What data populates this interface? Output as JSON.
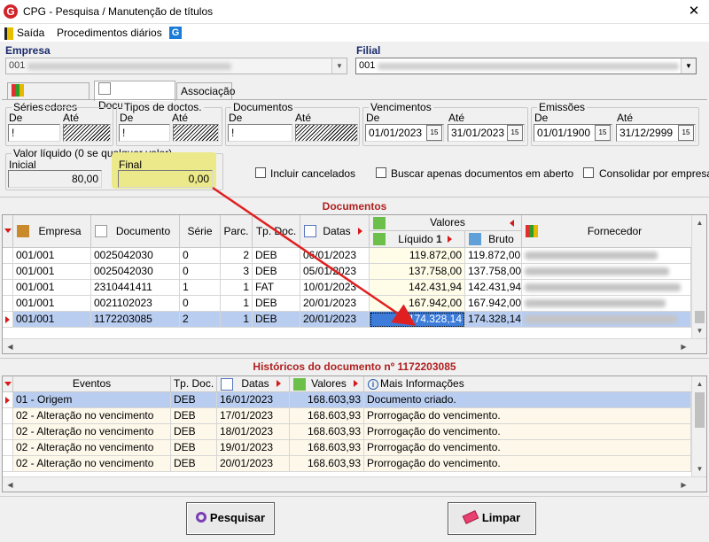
{
  "window": {
    "title": "CPG - Pesquisa / Manutenção de títulos",
    "close_glyph": "✕"
  },
  "menu": {
    "items": [
      "Saída",
      "Procedimentos diários"
    ]
  },
  "empresa": {
    "label": "Empresa",
    "value": "001"
  },
  "filial": {
    "label": "Filial",
    "value": "001"
  },
  "tabs": [
    "Fornecedores",
    "Documentos",
    "Associação"
  ],
  "filters": {
    "series": {
      "title": "Séries",
      "de_label": "De",
      "ate_label": "Até",
      "de_value": "!",
      "ate_value": ""
    },
    "tipos": {
      "title": "Tipos de doctos.",
      "de_label": "De",
      "ate_label": "Até",
      "de_value": "!",
      "ate_value": ""
    },
    "documentos": {
      "title": "Documentos",
      "de_label": "De",
      "ate_label": "Até",
      "de_value": "!",
      "ate_value": ""
    },
    "vencimentos": {
      "title": "Vencimentos",
      "de_label": "De",
      "ate_label": "Até",
      "de_value": "01/01/2023",
      "ate_value": "31/01/2023",
      "cal_label": "15"
    },
    "emissoes": {
      "title": "Emissões",
      "de_label": "De",
      "ate_label": "Até",
      "de_value": "01/01/1900",
      "ate_value": "31/12/2999",
      "cal_label": "15"
    },
    "valor": {
      "title": "Valor líquido (0 se qualquer valor)",
      "inicial_label": "Inicial",
      "inicial_value": "80,00",
      "final_label": "Final",
      "final_value": "0,00"
    },
    "checkboxes": [
      "Incluir cancelados",
      "Buscar apenas documentos em aberto",
      "Consolidar por empresa"
    ]
  },
  "documentos_grid": {
    "title": "Documentos",
    "group_header": "Valores",
    "columns": [
      "Empresa",
      "Documento",
      "Série",
      "Parc.",
      "Tp. Doc.",
      "Datas",
      "Líquido",
      "Bruto",
      "Fornecedor"
    ],
    "sort_indicator": "1",
    "rows": [
      [
        "001/001",
        "0025042030",
        "0",
        "2",
        "DEB",
        "06/01/2023",
        "119.872,00",
        "119.872,00"
      ],
      [
        "001/001",
        "0025042030",
        "0",
        "3",
        "DEB",
        "05/01/2023",
        "137.758,00",
        "137.758,00"
      ],
      [
        "001/001",
        "2310441411",
        "1",
        "1",
        "FAT",
        "10/01/2023",
        "142.431,94",
        "142.431,94"
      ],
      [
        "001/001",
        "0021102023",
        "0",
        "1",
        "DEB",
        "20/01/2023",
        "167.942,00",
        "167.942,00"
      ],
      [
        "001/001",
        "1172203085",
        "2",
        "1",
        "DEB",
        "20/01/2023",
        "174.328,14",
        "174.328,14"
      ]
    ]
  },
  "historicos_grid": {
    "title": "Históricos do documento nº 1172203085",
    "columns": [
      "Eventos",
      "Tp. Doc.",
      "Datas",
      "Valores",
      "Mais Informações"
    ],
    "rows": [
      [
        "01 - Origem",
        "DEB",
        "16/01/2023",
        "168.603,93",
        "Documento criado."
      ],
      [
        "02 - Alteração no vencimento",
        "DEB",
        "17/01/2023",
        "168.603,93",
        "Prorrogação do vencimento."
      ],
      [
        "02 - Alteração no vencimento",
        "DEB",
        "18/01/2023",
        "168.603,93",
        "Prorrogação do vencimento."
      ],
      [
        "02 - Alteração no vencimento",
        "DEB",
        "19/01/2023",
        "168.603,93",
        "Prorrogação do vencimento."
      ],
      [
        "02 - Alteração no vencimento",
        "DEB",
        "20/01/2023",
        "168.603,93",
        "Prorrogação do vencimento."
      ]
    ]
  },
  "buttons": {
    "pesquisar": "Pesquisar",
    "limpar": "Limpar"
  },
  "colors": {
    "accent_title": "#b02020",
    "selection": "#b9cdf0",
    "highlight": "#ece98a",
    "arrow": "#e02020"
  }
}
